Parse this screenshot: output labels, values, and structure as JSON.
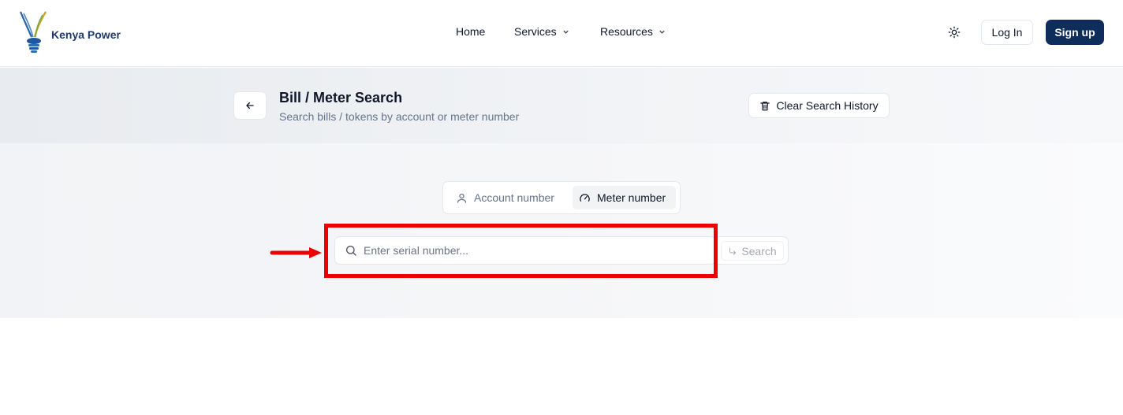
{
  "brand": {
    "name": "Kenya Power"
  },
  "nav": {
    "items": [
      {
        "label": "Home",
        "has_dropdown": false
      },
      {
        "label": "Services",
        "has_dropdown": true
      },
      {
        "label": "Resources",
        "has_dropdown": true
      }
    ],
    "theme_icon": "sun-icon",
    "login_label": "Log In",
    "signup_label": "Sign up"
  },
  "page": {
    "title": "Bill / Meter Search",
    "subtitle": "Search bills / tokens by account or meter number",
    "clear_history_label": "Clear Search History"
  },
  "search": {
    "tabs": [
      {
        "label": "Account number",
        "icon": "user-icon",
        "active": false
      },
      {
        "label": "Meter number",
        "icon": "gauge-icon",
        "active": true
      }
    ],
    "placeholder": "Enter serial number...",
    "value": "",
    "button_label": "Search"
  },
  "colors": {
    "primary": "#0f2d5a",
    "annotation": "#ee0000",
    "brand_text": "#1e3a6e"
  }
}
